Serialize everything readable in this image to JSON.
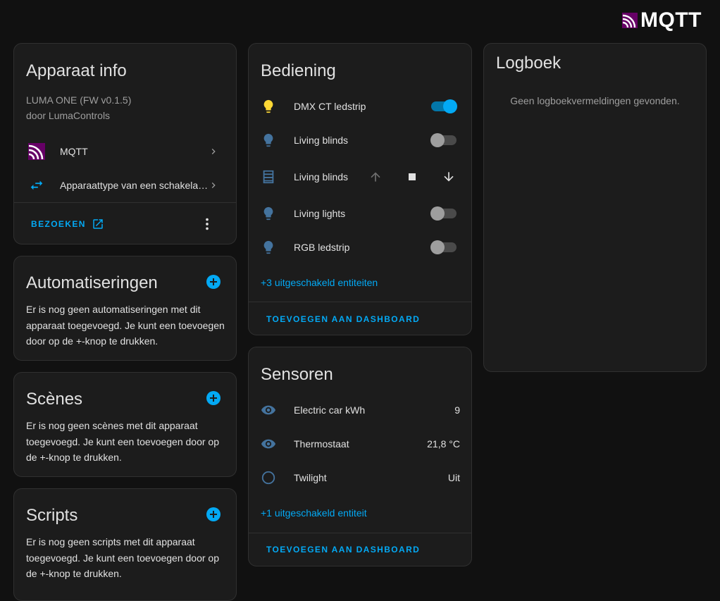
{
  "brand": {
    "logo_text": "MQTT"
  },
  "device_info": {
    "title": "Apparaat info",
    "model": "LUMA ONE (FW v0.1.5)",
    "manufacturer": "door LumaControls",
    "integrations": [
      {
        "label": "MQTT",
        "icon": "mqtt-logo-icon"
      },
      {
        "label": "Apparaattype van een schakela…",
        "icon": "swap-horizontal-icon"
      }
    ],
    "visit_label": "BEZOEKEN"
  },
  "automations": {
    "title": "Automatiseringen",
    "text": "Er is nog geen automatiseringen met dit apparaat toegevoegd. Je kunt een toevoegen door op de +-knop te drukken."
  },
  "scenes": {
    "title": "Scènes",
    "text": "Er is nog geen scènes met dit apparaat toegevoegd. Je kunt een toevoegen door op de +-knop te drukken."
  },
  "scripts": {
    "title": "Scripts",
    "text": "Er is nog geen scripts met dit apparaat toegevoegd. Je kunt een toevoegen door op de +-knop te drukken."
  },
  "controls": {
    "title": "Bediening",
    "entities": [
      {
        "label": "DMX CT ledstrip",
        "icon": "lightbulb-icon",
        "state": "on"
      },
      {
        "label": "Living blinds",
        "icon": "lightbulb-icon",
        "state": "off"
      },
      {
        "label": "Living blinds",
        "icon": "window-shutter-icon",
        "state": "cover"
      },
      {
        "label": "Living lights",
        "icon": "lightbulb-icon",
        "state": "off"
      },
      {
        "label": "RGB ledstrip",
        "icon": "lightbulb-icon",
        "state": "off"
      }
    ],
    "hidden_link": "+3 uitgeschakeld entiteiten",
    "add_label": "TOEVOEGEN AAN DASHBOARD"
  },
  "sensors": {
    "title": "Sensoren",
    "entities": [
      {
        "label": "Electric car kWh",
        "icon": "eye-icon",
        "value": "9"
      },
      {
        "label": "Thermostaat",
        "icon": "eye-icon",
        "value": "21,8 °C"
      },
      {
        "label": "Twilight",
        "icon": "circle-outline-icon",
        "value": "Uit"
      }
    ],
    "hidden_link": "+1 uitgeschakeld entiteit",
    "add_label": "TOEVOEGEN AAN DASHBOARD"
  },
  "logbook": {
    "title": "Logboek",
    "empty_text": "Geen logboekvermeldingen gevonden."
  },
  "colors": {
    "accent": "#03a9f4",
    "icon_blue": "#44739e",
    "bulb_on": "#fdd835",
    "card": "#1c1c1c",
    "background": "#111111"
  }
}
